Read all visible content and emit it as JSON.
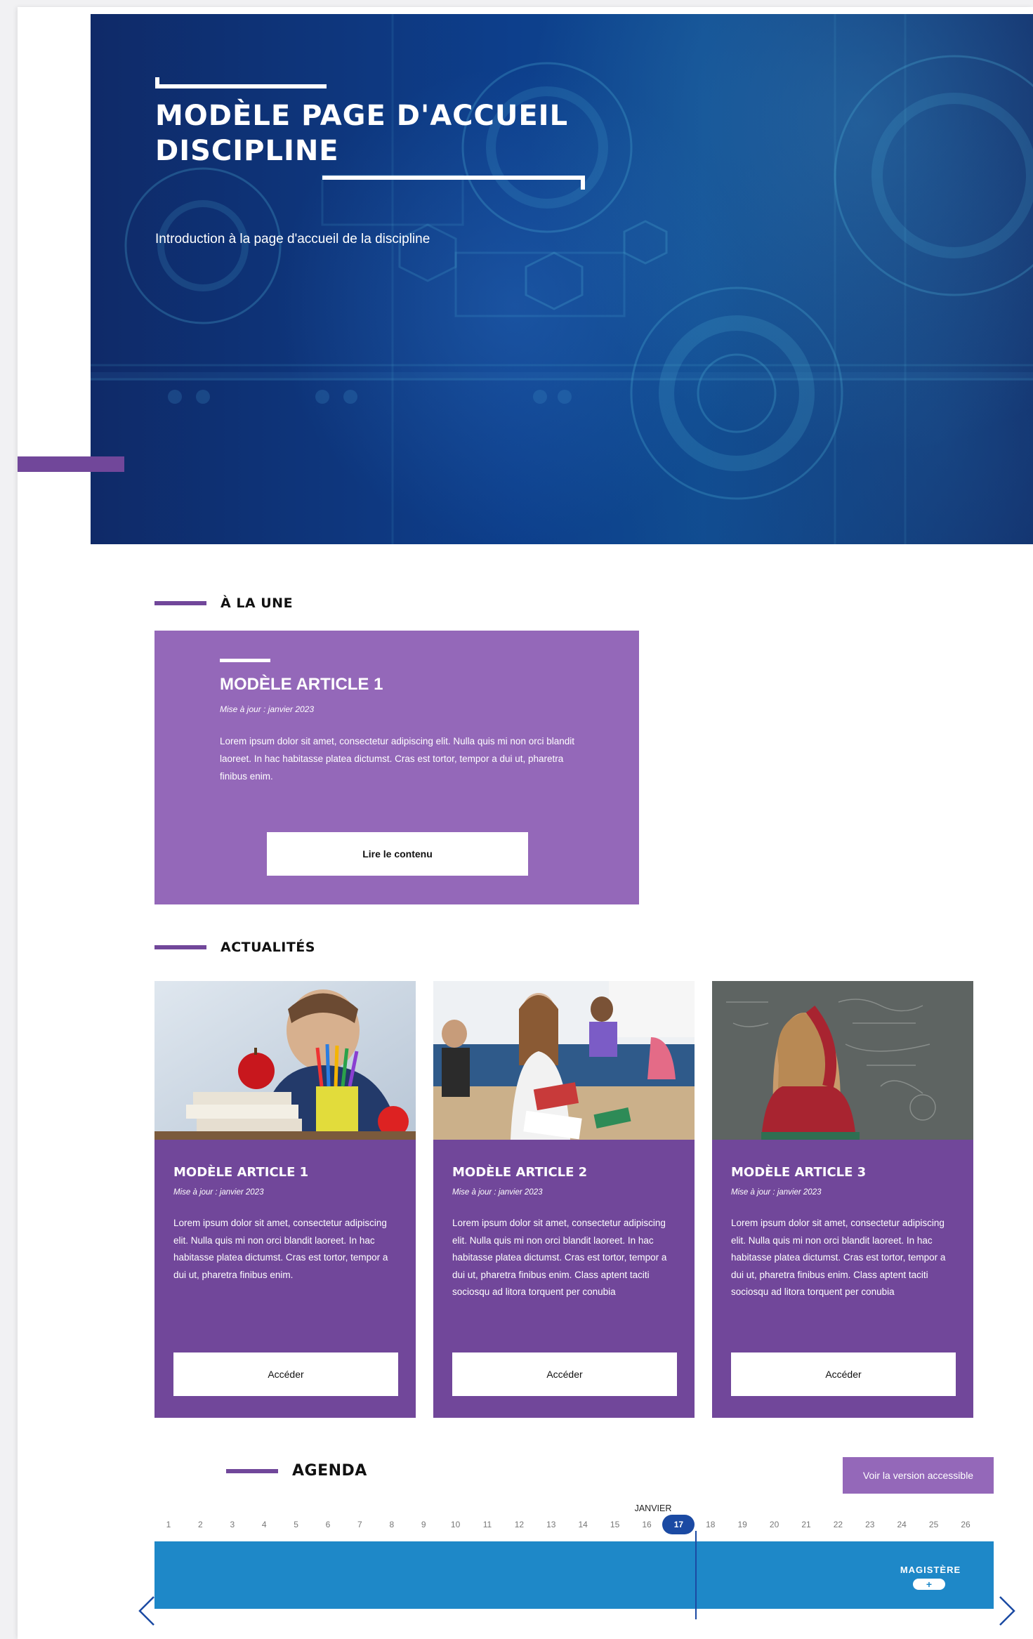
{
  "hero": {
    "title_line1": "MODÈLE PAGE D'ACCUEIL",
    "title_line2": "DISCIPLINE",
    "intro": "Introduction à la page d'accueil de la discipline"
  },
  "a_la_une": {
    "heading": "À LA UNE",
    "card": {
      "title": "MODÈLE ARTICLE 1",
      "date": "Mise à jour : janvier 2023",
      "text": "Lorem ipsum dolor sit amet, consectetur adipiscing elit. Nulla quis mi non orci blandit laoreet. In hac habitasse platea dictumst. Cras est tortor, tempor a dui ut, pharetra finibus enim.",
      "button": "Lire le contenu"
    }
  },
  "actualites": {
    "heading": "ACTUALITÉS",
    "cards": [
      {
        "title": "MODÈLE ARTICLE 1",
        "date": "Mise à jour : janvier 2023",
        "text": "Lorem ipsum dolor sit amet, consectetur adipiscing elit. Nulla quis mi non orci blandit laoreet. In hac habitasse platea dictumst. Cras est tortor, tempor a dui ut, pharetra finibus enim.",
        "button": "Accéder"
      },
      {
        "title": "MODÈLE ARTICLE 2",
        "date": "Mise à jour : janvier 2023",
        "text": "Lorem ipsum dolor sit amet, consectetur adipiscing elit. Nulla quis mi non orci blandit laoreet. In hac habitasse platea dictumst. Cras est tortor, tempor a dui ut, pharetra finibus enim. Class aptent taciti sociosqu ad litora torquent per conubia",
        "button": "Accéder"
      },
      {
        "title": "MODÈLE ARTICLE 3",
        "date": "Mise à jour : janvier 2023",
        "text": "Lorem ipsum dolor sit amet, consectetur adipiscing elit. Nulla quis mi non orci blandit laoreet. In hac habitasse platea dictumst. Cras est tortor, tempor a dui ut, pharetra finibus enim. Class aptent taciti sociosqu ad litora torquent per conubia",
        "button": "Accéder"
      }
    ]
  },
  "agenda": {
    "heading": "AGENDA",
    "accessible_button": "Voir la version accessible",
    "month": "JANVIER",
    "days": [
      "1",
      "2",
      "3",
      "4",
      "5",
      "6",
      "7",
      "8",
      "9",
      "10",
      "11",
      "12",
      "13",
      "14",
      "15",
      "16",
      "17",
      "18",
      "19",
      "20",
      "21",
      "22",
      "23",
      "24",
      "25",
      "26"
    ],
    "today": "17",
    "event": {
      "label": "MAGISTÈRE",
      "plus": "+"
    },
    "scroll_progress": 0.85
  },
  "icons": {
    "prev": "chevron-left-icon",
    "next": "chevron-right-icon"
  },
  "colors": {
    "purple_dark": "#71479a",
    "purple_light": "#9468b9",
    "agenda_blue": "#1e88c8",
    "today_blue": "#1b4aa3"
  }
}
